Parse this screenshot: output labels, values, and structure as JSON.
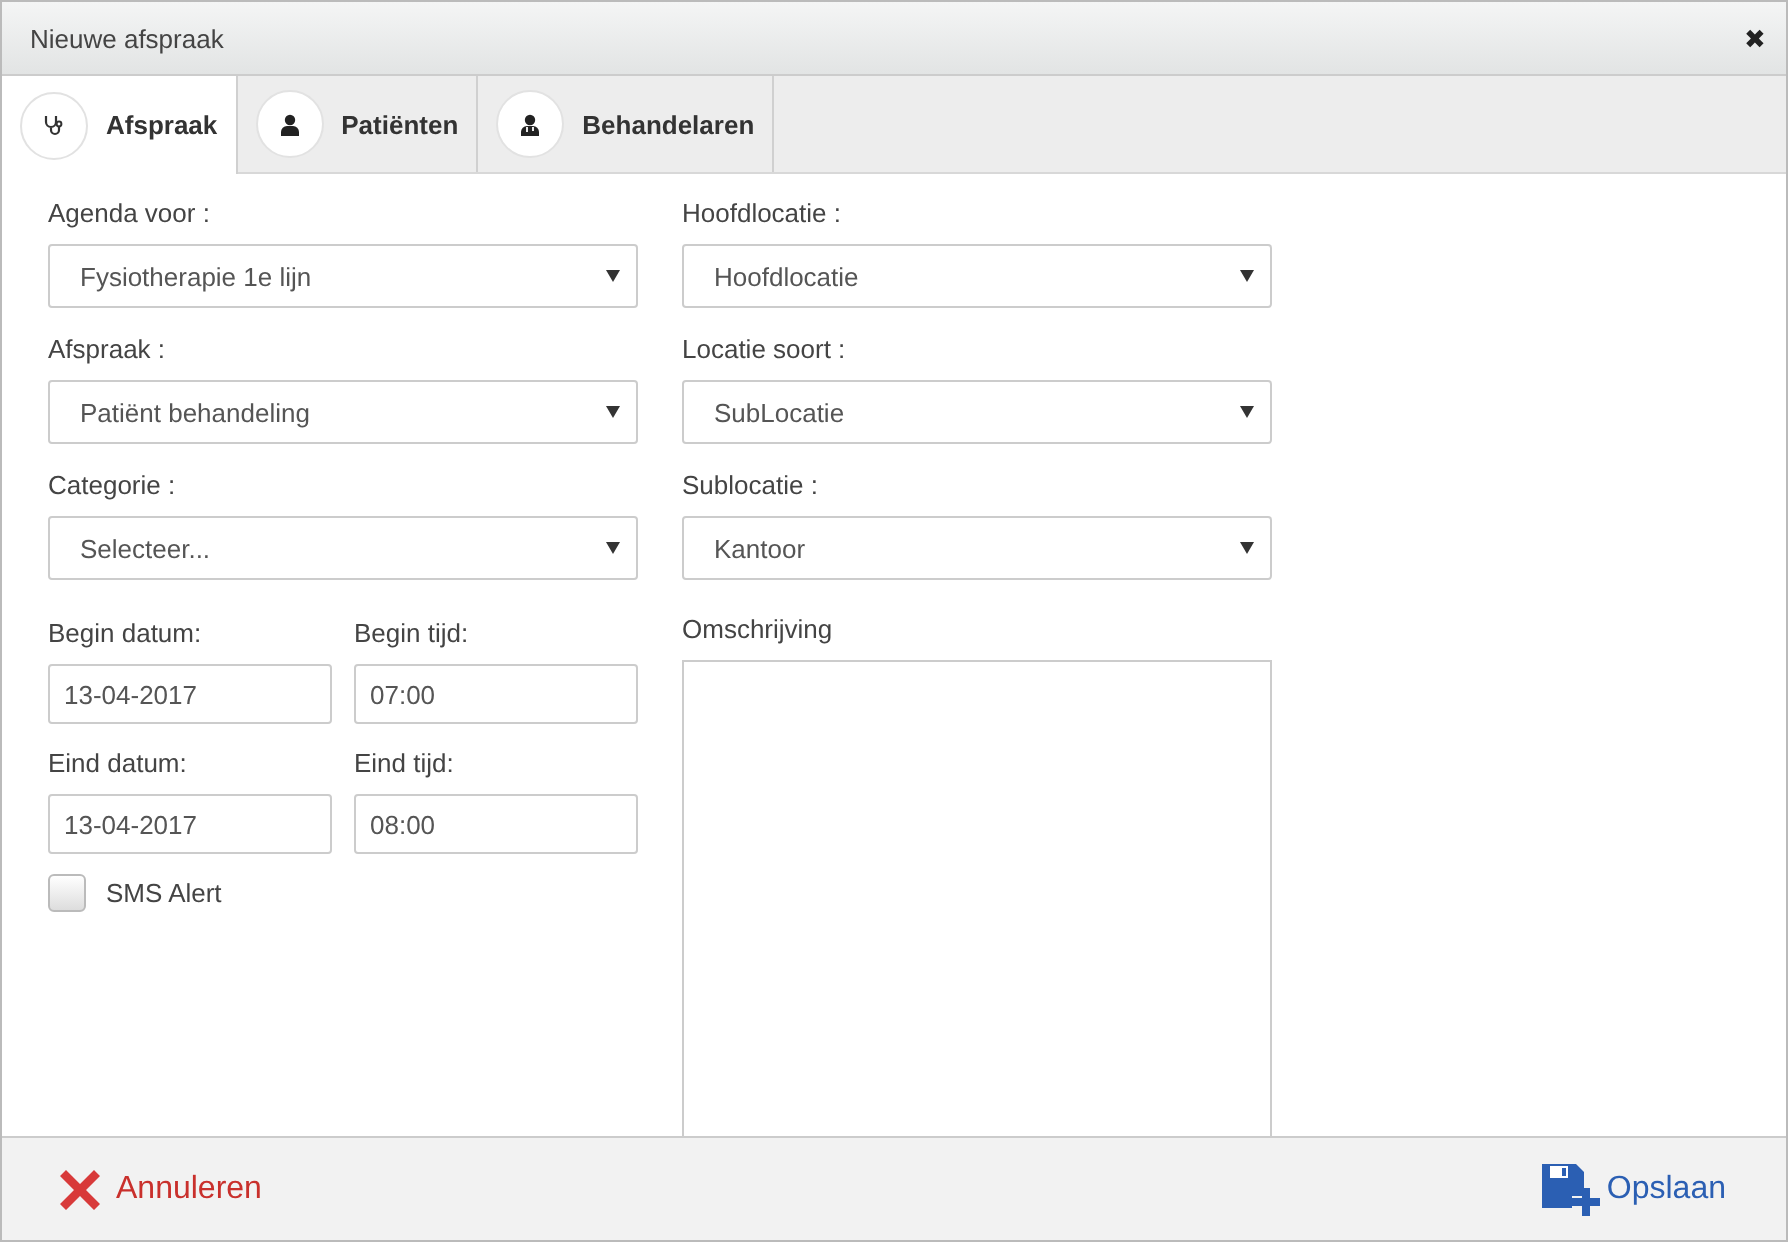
{
  "window": {
    "title": "Nieuwe afspraak",
    "close": "✖"
  },
  "tabs": [
    {
      "label": "Afspraak",
      "selected": true
    },
    {
      "label": "Patiënten",
      "selected": false
    },
    {
      "label": "Behandelaren",
      "selected": false
    }
  ],
  "left_selects": [
    {
      "label": "Agenda voor :",
      "value": "Fysiotherapie 1e lijn"
    },
    {
      "label": "Afspraak :",
      "value": "Patiënt behandeling"
    },
    {
      "label": "Categorie :",
      "value": "Selecteer..."
    }
  ],
  "datetime_fields": [
    {
      "label": "Begin datum:",
      "value": "13-04-2017"
    },
    {
      "label": "Begin tijd:",
      "value": "07:00"
    },
    {
      "label": "Eind datum:",
      "value": "13-04-2017"
    },
    {
      "label": "Eind tijd:",
      "value": "08:00"
    }
  ],
  "sms_alert": {
    "label": "SMS Alert",
    "checked": false
  },
  "right_selects": [
    {
      "label": "Hoofdlocatie :",
      "value": "Hoofdlocatie"
    },
    {
      "label": "Locatie soort :",
      "value": "SubLocatie"
    },
    {
      "label": "Sublocatie :",
      "value": "Kantoor"
    }
  ],
  "description": {
    "label": "Omschrijving"
  },
  "footer": {
    "cancel": "Annuleren",
    "save": "Opslaan"
  }
}
